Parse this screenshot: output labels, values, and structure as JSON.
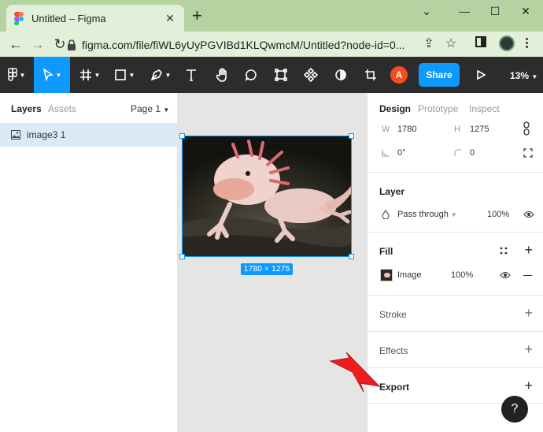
{
  "browser": {
    "tab_title": "Untitled – Figma",
    "tab_close": "✕",
    "new_tab": "+",
    "url": "figma.com/file/fiWL6yUyPGVIBd1KLQwmcM/Untitled?node-id=0...",
    "window": {
      "minimize": "⌄",
      "restore": "—",
      "maximize": "☐",
      "close": "✕"
    }
  },
  "toolbar": {
    "share_label": "Share",
    "user_initial": "A",
    "zoom": "13%"
  },
  "left_panel": {
    "tabs": [
      "Layers",
      "Assets"
    ],
    "page": "Page 1",
    "layers": [
      {
        "name": "image3 1"
      }
    ]
  },
  "canvas": {
    "selection_size": "1780 × 1275"
  },
  "right_panel": {
    "tabs": [
      "Design",
      "Prototype",
      "Inspect"
    ],
    "w_label": "W",
    "w_value": "1780",
    "h_label": "H",
    "h_value": "1275",
    "rotation": "0°",
    "radius": "0",
    "layer": {
      "title": "Layer",
      "blend": "Pass through",
      "opacity": "100%"
    },
    "fill": {
      "title": "Fill",
      "type": "Image",
      "opacity": "100%"
    },
    "stroke": {
      "title": "Stroke"
    },
    "effects": {
      "title": "Effects"
    },
    "export": {
      "title": "Export"
    },
    "help": "?"
  },
  "colors": {
    "accent": "#0d99ff",
    "toolbar": "#2c2c2c",
    "arrow": "#ee1c1c",
    "browser_frame": "#b5d2a1"
  }
}
